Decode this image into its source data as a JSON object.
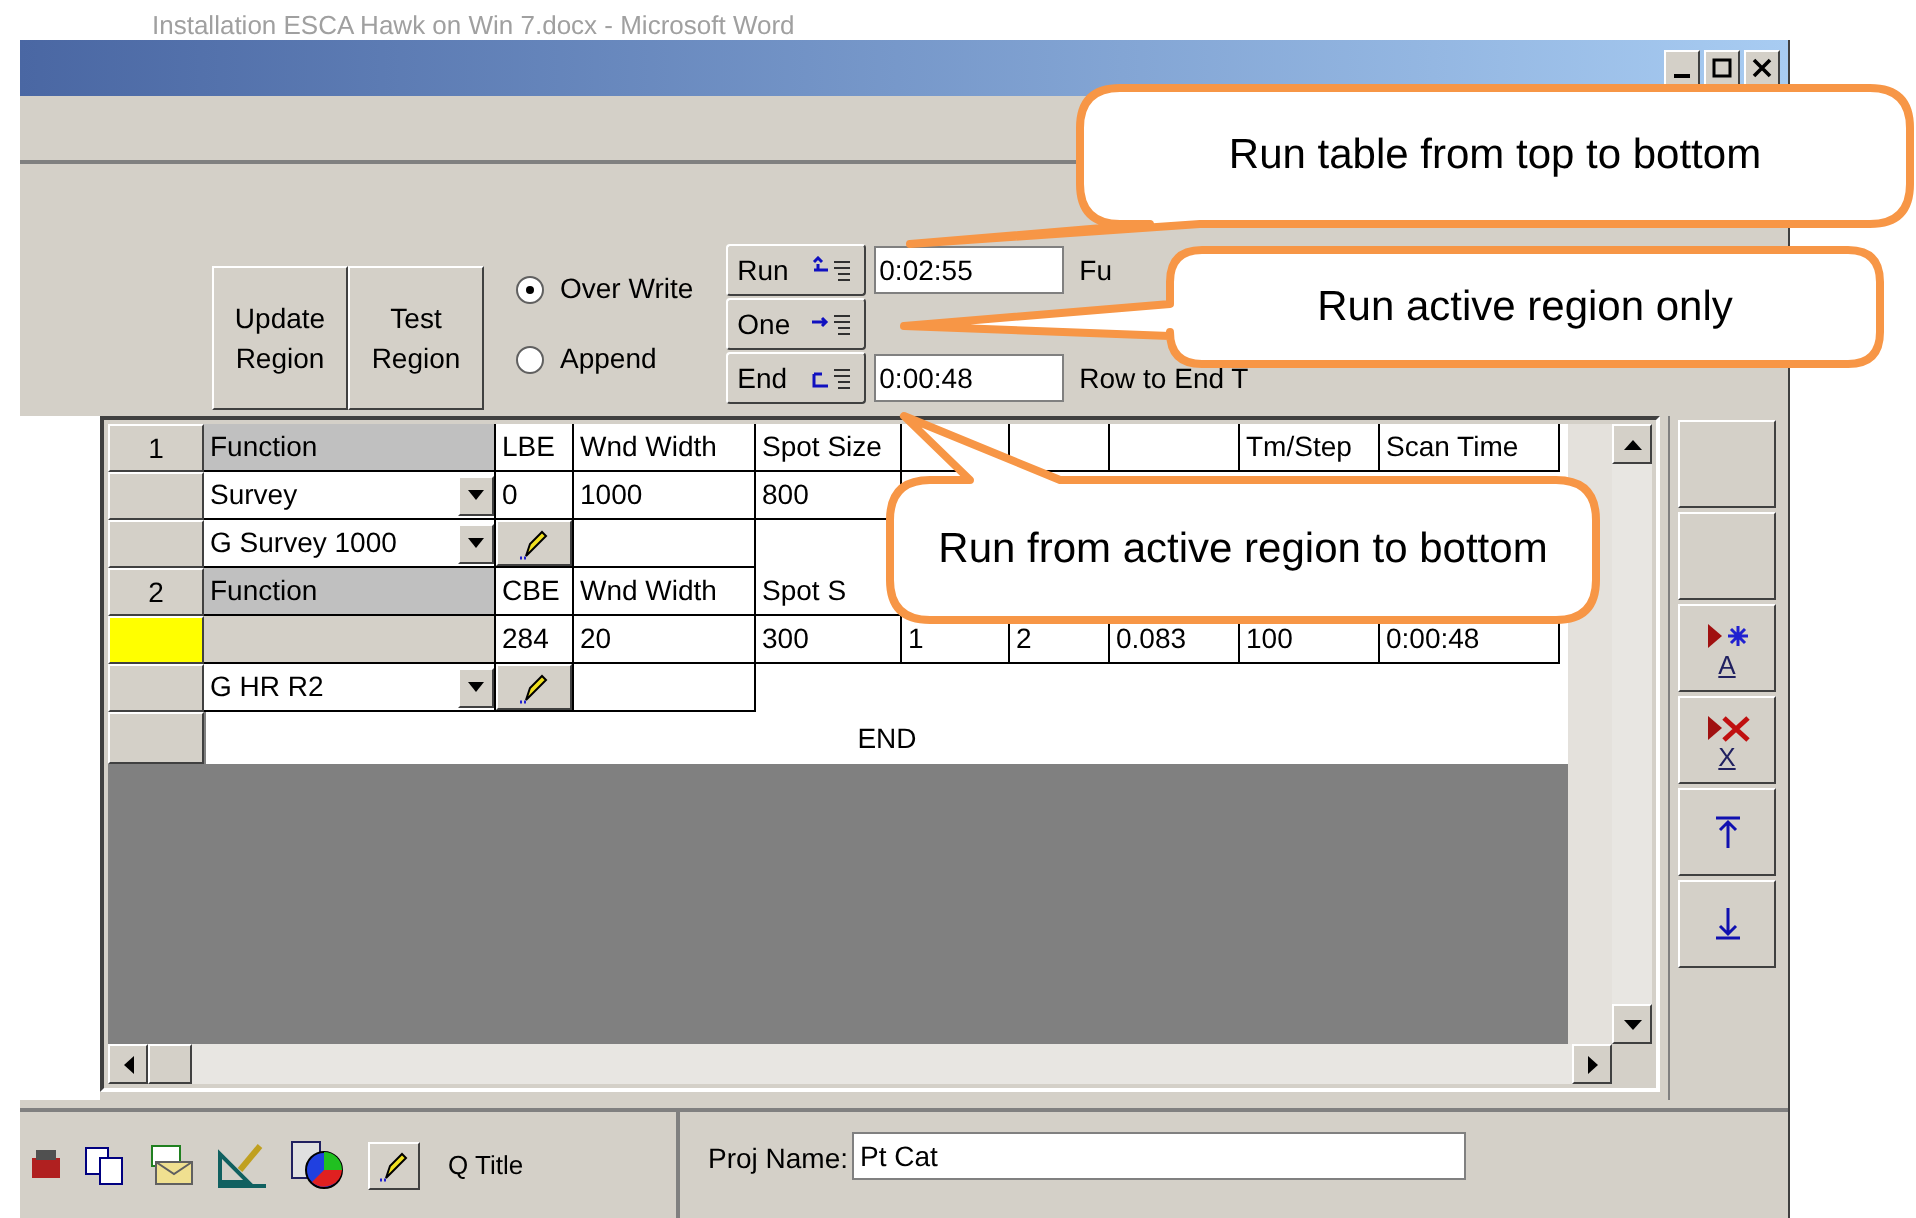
{
  "document_title": "Installation ESCA Hawk on Win 7.docx - Microsoft Word",
  "region_buttons": [
    "Update Region",
    "Test Region"
  ],
  "write_mode": [
    {
      "label": "Over Write",
      "selected": true
    },
    {
      "label": "Append",
      "selected": false
    }
  ],
  "run_buttons": [
    {
      "label": "Run",
      "kind": "top",
      "time": "0:02:55",
      "caption": "Fu"
    },
    {
      "label": "One",
      "kind": "one"
    },
    {
      "label": "End",
      "kind": "end",
      "time": "0:00:48",
      "caption": "Row to End T"
    }
  ],
  "table": {
    "rows": [
      {
        "kind": "header",
        "number": "1",
        "function": "Function",
        "cells": [
          "LBE",
          "Wnd Width",
          "Spot Size",
          null,
          null,
          null,
          "Tm/Step",
          "Scan Time"
        ]
      },
      {
        "kind": "data",
        "active": false,
        "function": "Survey",
        "cells": [
          "0",
          "1000",
          "800"
        ]
      },
      {
        "kind": "preset",
        "active": false,
        "function": "G Survey 1000",
        "cells": [
          null
        ]
      },
      {
        "kind": "header",
        "number": "2",
        "function": "Function",
        "cells": [
          "CBE",
          "Wnd Width",
          "Spot S"
        ]
      },
      {
        "kind": "data",
        "active": true,
        "cells": [
          "284",
          "20",
          "300",
          "1",
          "2",
          "0.083",
          "100",
          "0:00:48"
        ]
      },
      {
        "kind": "preset",
        "active": false,
        "function": "G HR R2",
        "cells": [
          null
        ]
      },
      {
        "kind": "end",
        "label": "END"
      }
    ]
  },
  "side_tools": [
    {
      "kind": "insert",
      "letter": "A"
    },
    {
      "kind": "delete",
      "letter": "X"
    },
    {
      "kind": "top"
    },
    {
      "kind": "bottom"
    }
  ],
  "bottom_toolbar": {
    "title_label": "Q Title"
  },
  "project": {
    "label": "Proj Name:",
    "value": "Pt Cat"
  },
  "callouts": [
    {
      "text": "Run table from top to bottom"
    },
    {
      "text": "Run active region only"
    },
    {
      "text": "Run from active region to bottom"
    }
  ]
}
